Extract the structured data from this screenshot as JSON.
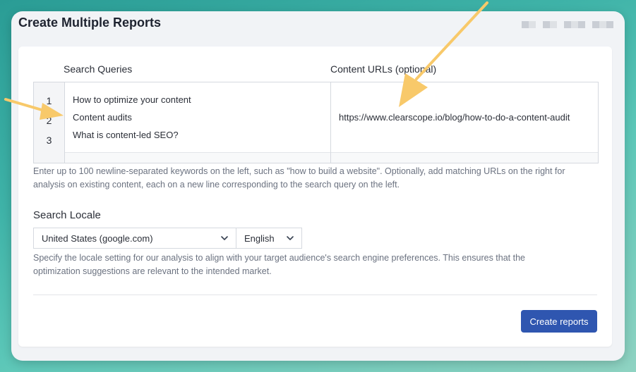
{
  "window": {
    "title": "Create Multiple Reports"
  },
  "editor": {
    "queries_label": "Search Queries",
    "urls_label": "Content URLs (optional)",
    "line_numbers": [
      "1",
      "2",
      "3"
    ],
    "queries": [
      "How to optimize your content",
      "Content audits",
      "What is content-led SEO?"
    ],
    "urls": [
      "https://www.clearscope.io/blog/how-to-do-a-content-audit"
    ],
    "help_line1": "Enter up to 100 newline-separated keywords on the left, such as \"how to build a website\". Optionally, add matching URLs on the right for",
    "help_line2": "analysis on existing content, each on a new line corresponding to the search query on the left."
  },
  "locale": {
    "label": "Search Locale",
    "country": "United States (google.com)",
    "language": "English",
    "help_line1": "Specify the locale setting for our analysis to align with your target audience's search engine preferences. This ensures that the",
    "help_line2": "optimization suggestions are relevant to the intended market."
  },
  "actions": {
    "create_label": "Create reports"
  },
  "colors": {
    "primary_button": "#2f56b0",
    "annotation_arrow": "#f8c96a"
  },
  "icons": [
    "chevron-down-icon",
    "annotation-arrow"
  ]
}
